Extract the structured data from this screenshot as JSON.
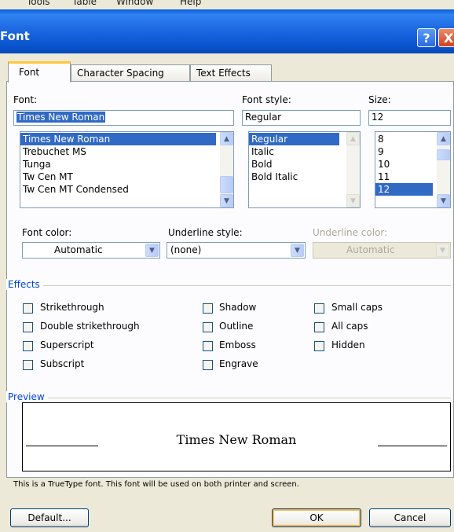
{
  "menubar": [
    "Tools",
    "Table",
    "Window",
    "Help"
  ],
  "dialog": {
    "title": "Font"
  },
  "titlebar": {
    "help": "?",
    "close": "X"
  },
  "tabs": [
    "Font",
    "Character Spacing",
    "Text Effects"
  ],
  "font": {
    "label": "Font:",
    "value": "Times New Roman",
    "list": [
      "Times New Roman",
      "Trebuchet MS",
      "Tunga",
      "Tw Cen MT",
      "Tw Cen MT Condensed"
    ]
  },
  "style": {
    "label": "Font style:",
    "value": "Regular",
    "list": [
      "Regular",
      "Italic",
      "Bold",
      "Bold Italic"
    ]
  },
  "size": {
    "label": "Size:",
    "value": "12",
    "list": [
      "8",
      "9",
      "10",
      "11",
      "12"
    ]
  },
  "font_color": {
    "label": "Font color:",
    "value": "Automatic"
  },
  "underline_style": {
    "label": "Underline style:",
    "value": "(none)"
  },
  "underline_color": {
    "label": "Underline color:",
    "value": "Automatic"
  },
  "effects": {
    "title": "Effects",
    "col1": [
      "Strikethrough",
      "Double strikethrough",
      "Superscript",
      "Subscript"
    ],
    "col2": [
      "Shadow",
      "Outline",
      "Emboss",
      "Engrave"
    ],
    "col3": [
      "Small caps",
      "All caps",
      "Hidden"
    ]
  },
  "preview": {
    "title": "Preview",
    "text": "Times New Roman"
  },
  "note": "This is a TrueType font. This font will be used on both printer and screen.",
  "buttons": {
    "default": "Default...",
    "ok": "OK",
    "cancel": "Cancel"
  },
  "colors": {
    "title_bar": "#0a55d0",
    "selection": "#316ac5",
    "group_title": "#0046d5",
    "active_tab_accent": "#ffc83c"
  }
}
